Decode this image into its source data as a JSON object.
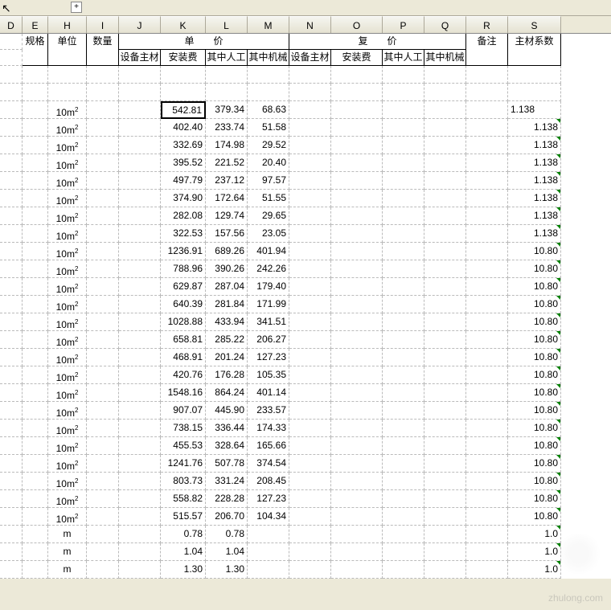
{
  "toolbar": {
    "btn": "+"
  },
  "columns": [
    "D",
    "E",
    "H",
    "I",
    "J",
    "K",
    "L",
    "M",
    "N",
    "O",
    "P",
    "Q",
    "R",
    "S"
  ],
  "header": {
    "spec": "规格",
    "unit": "单位",
    "qty": "数量",
    "unitprice": "单　　价",
    "compprice": "复　　价",
    "remark": "备注",
    "coef": "主材系数",
    "sub": {
      "equip": "设备主材",
      "install": "安装费",
      "labor": "其中人工",
      "machine": "其中机械"
    }
  },
  "rows": [
    {
      "unit": "10m²",
      "k": "542.81",
      "l": "379.34",
      "m": "68.63",
      "s": "1.138"
    },
    {
      "unit": "10m²",
      "k": "402.40",
      "l": "233.74",
      "m": "51.58",
      "s": "1.138"
    },
    {
      "unit": "10m²",
      "k": "332.69",
      "l": "174.98",
      "m": "29.52",
      "s": "1.138"
    },
    {
      "unit": "10m²",
      "k": "395.52",
      "l": "221.52",
      "m": "20.40",
      "s": "1.138"
    },
    {
      "unit": "10m²",
      "k": "497.79",
      "l": "237.12",
      "m": "97.57",
      "s": "1.138"
    },
    {
      "unit": "10m²",
      "k": "374.90",
      "l": "172.64",
      "m": "51.55",
      "s": "1.138"
    },
    {
      "unit": "10m²",
      "k": "282.08",
      "l": "129.74",
      "m": "29.65",
      "s": "1.138"
    },
    {
      "unit": "10m²",
      "k": "322.53",
      "l": "157.56",
      "m": "23.05",
      "s": "1.138"
    },
    {
      "unit": "10m²",
      "k": "1236.91",
      "l": "689.26",
      "m": "401.94",
      "s": "10.80"
    },
    {
      "unit": "10m²",
      "k": "788.96",
      "l": "390.26",
      "m": "242.26",
      "s": "10.80"
    },
    {
      "unit": "10m²",
      "k": "629.87",
      "l": "287.04",
      "m": "179.40",
      "s": "10.80"
    },
    {
      "unit": "10m²",
      "k": "640.39",
      "l": "281.84",
      "m": "171.99",
      "s": "10.80"
    },
    {
      "unit": "10m²",
      "k": "1028.88",
      "l": "433.94",
      "m": "341.51",
      "s": "10.80"
    },
    {
      "unit": "10m²",
      "k": "658.81",
      "l": "285.22",
      "m": "206.27",
      "s": "10.80"
    },
    {
      "unit": "10m²",
      "k": "468.91",
      "l": "201.24",
      "m": "127.23",
      "s": "10.80"
    },
    {
      "unit": "10m²",
      "k": "420.76",
      "l": "176.28",
      "m": "105.35",
      "s": "10.80"
    },
    {
      "unit": "10m²",
      "k": "1548.16",
      "l": "864.24",
      "m": "401.14",
      "s": "10.80"
    },
    {
      "unit": "10m²",
      "k": "907.07",
      "l": "445.90",
      "m": "233.57",
      "s": "10.80"
    },
    {
      "unit": "10m²",
      "k": "738.15",
      "l": "336.44",
      "m": "174.33",
      "s": "10.80"
    },
    {
      "unit": "10m²",
      "k": "455.53",
      "l": "328.64",
      "m": "165.66",
      "s": "10.80"
    },
    {
      "unit": "10m²",
      "k": "1241.76",
      "l": "507.78",
      "m": "374.54",
      "s": "10.80"
    },
    {
      "unit": "10m²",
      "k": "803.73",
      "l": "331.24",
      "m": "208.45",
      "s": "10.80"
    },
    {
      "unit": "10m²",
      "k": "558.82",
      "l": "228.28",
      "m": "127.23",
      "s": "10.80"
    },
    {
      "unit": "10m²",
      "k": "515.57",
      "l": "206.70",
      "m": "104.34",
      "s": "10.80"
    },
    {
      "unit": "m",
      "k": "0.78",
      "l": "0.78",
      "m": "",
      "s": "1.0"
    },
    {
      "unit": "m",
      "k": "1.04",
      "l": "1.04",
      "m": "",
      "s": "1.0"
    },
    {
      "unit": "m",
      "k": "1.30",
      "l": "1.30",
      "m": "",
      "s": "1.0"
    }
  ],
  "watermark": "zhulong.com"
}
